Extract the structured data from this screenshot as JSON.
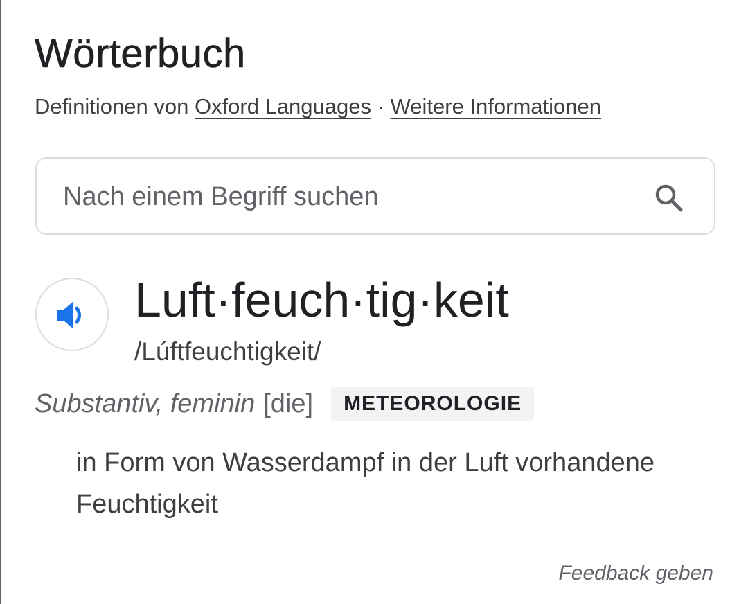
{
  "dictionary": {
    "title": "Wörterbuch",
    "source_prefix": "Definitionen von ",
    "source_link": "Oxford Languages",
    "separator": " · ",
    "more_info_link": "Weitere Informationen"
  },
  "search": {
    "placeholder": "Nach einem Begriff suchen",
    "value": "",
    "icon": "search-icon"
  },
  "entry": {
    "audio_icon": "speaker-icon",
    "headword": "Luft·feuch·tig·keit",
    "phonetic": "/Lúftfeuchtigkeit/",
    "part_of_speech": "Substantiv, feminin",
    "article": "[die]",
    "domain_label": "METEOROLOGIE",
    "definition": "in Form von Wasserdampf in der Luft vorhandene Feuchtigkeit"
  },
  "footer": {
    "feedback": "Feedback geben"
  },
  "colors": {
    "accent_blue": "#1a73e8",
    "text_primary": "#202124",
    "text_secondary": "#5f6368",
    "border": "#dadce0",
    "badge_bg": "#f1f3f4"
  }
}
